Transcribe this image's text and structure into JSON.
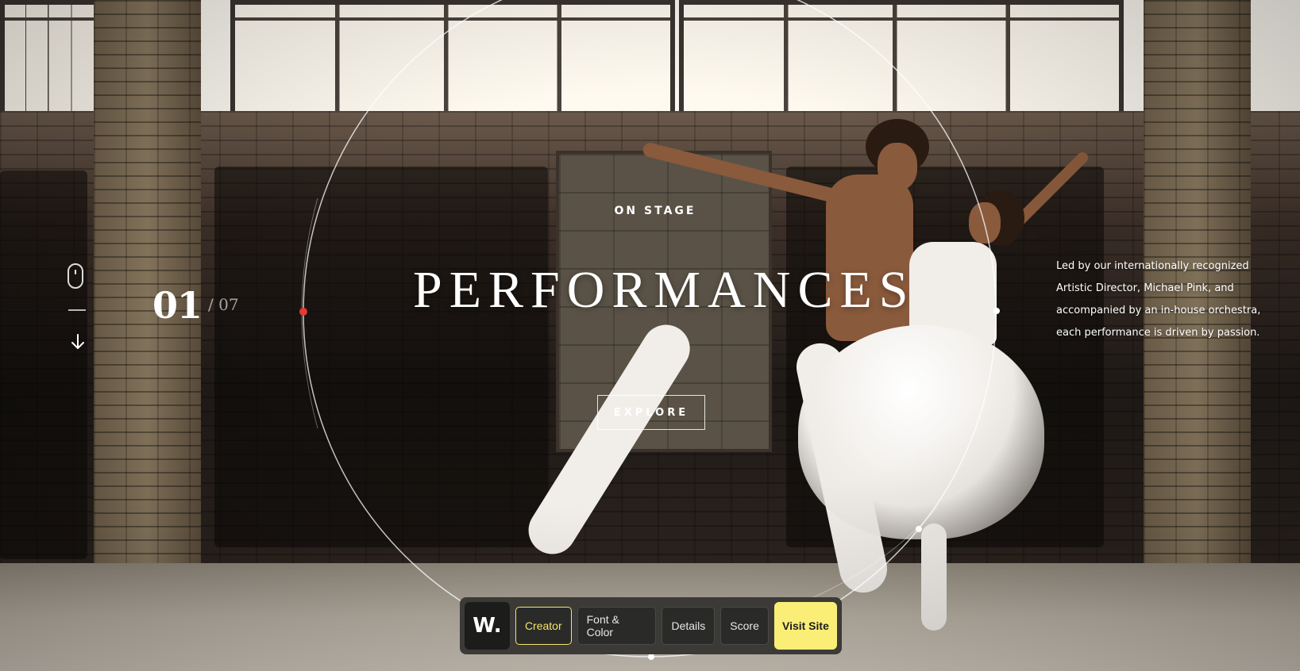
{
  "hero": {
    "kicker": "ON STAGE",
    "title": "PERFORMANCES",
    "explore_label": "EXPLORE",
    "description": "Led by our internationally recognized Artistic Director, Michael Pink, and accompanied by an in-house orchestra, each performance is driven by passion."
  },
  "slider": {
    "current": "01",
    "total": "/ 07"
  },
  "icons": {
    "scroll": "mouse-icon",
    "down": "arrow-down-icon"
  },
  "toolbar": {
    "logo": "W.",
    "tabs": [
      {
        "label": "Creator",
        "active": true
      },
      {
        "label": "Font & Color",
        "active": false
      },
      {
        "label": "Details",
        "active": false
      },
      {
        "label": "Score",
        "active": false
      }
    ],
    "visit_label": "Visit Site"
  },
  "colors": {
    "accent": "#fbee76",
    "toolbar_bg": "#3b3a37",
    "indicator_dot": "#e53935"
  }
}
